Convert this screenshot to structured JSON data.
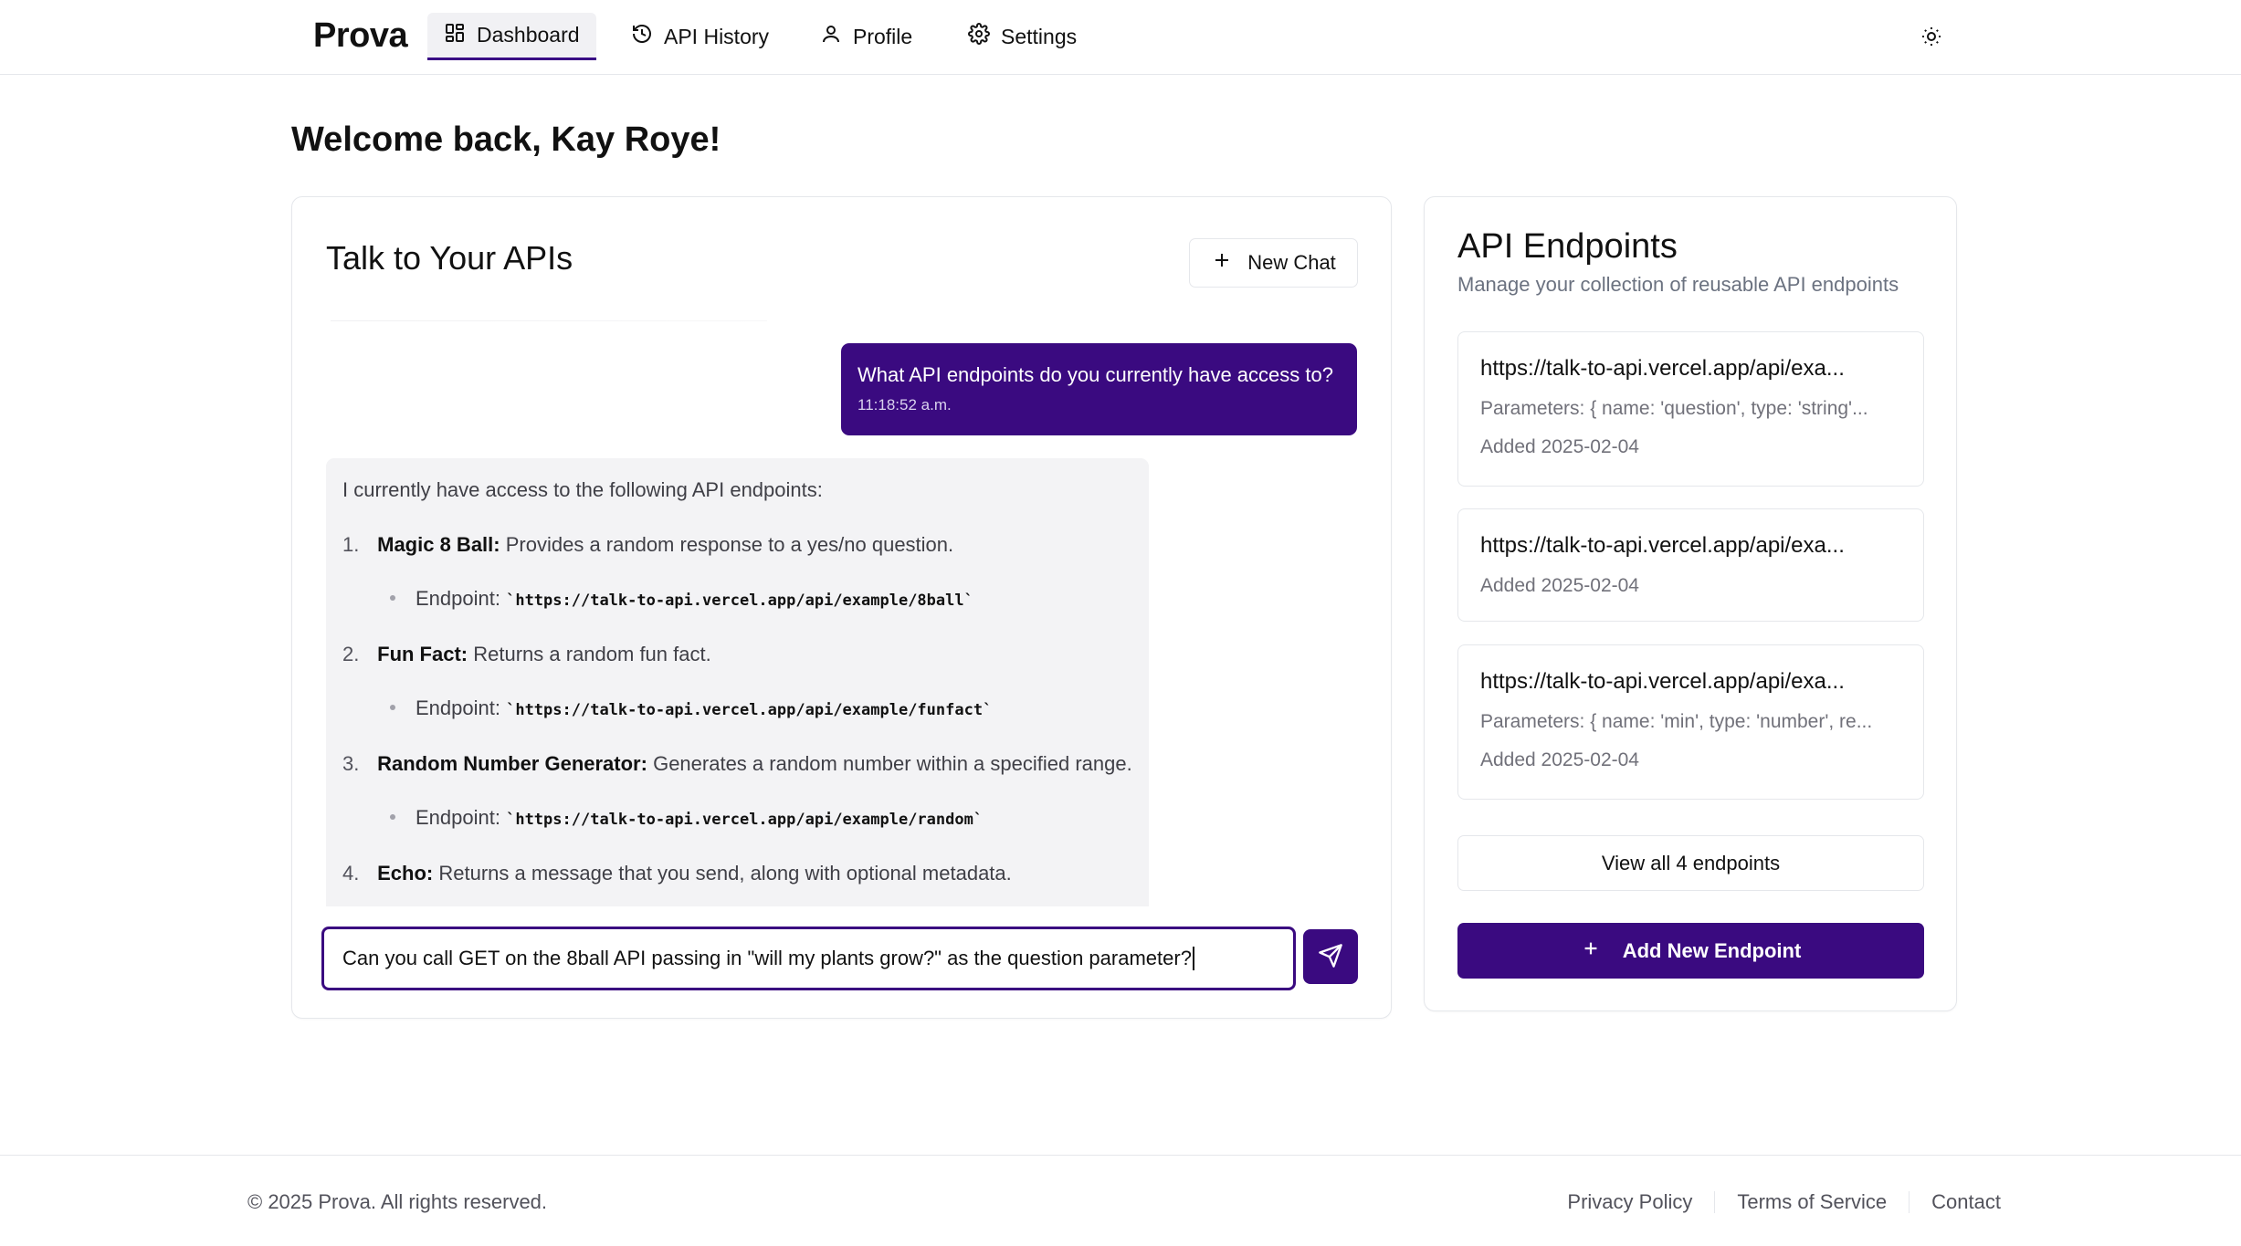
{
  "nav": {
    "brand": "Prova",
    "items": [
      {
        "label": "Dashboard",
        "icon": "dashboard-icon",
        "active": true
      },
      {
        "label": "API History",
        "icon": "history-icon",
        "active": false
      },
      {
        "label": "Profile",
        "icon": "user-icon",
        "active": false
      },
      {
        "label": "Settings",
        "icon": "gear-icon",
        "active": false
      }
    ],
    "theme_icon": "sun-icon"
  },
  "page": {
    "title": "Welcome back, Kay Roye!"
  },
  "chat": {
    "title": "Talk to Your APIs",
    "new_chat_label": "New Chat",
    "user_message": {
      "text": "What API endpoints do you currently have access to?",
      "time": "11:18:52 a.m."
    },
    "bot_message": {
      "intro": "I currently have access to the following API endpoints:",
      "endpoint_prefix": "Endpoint:",
      "items": [
        {
          "num": "1.",
          "name": "Magic 8 Ball:",
          "desc": "Provides a random response to a yes/no question.",
          "endpoint": "`https://talk-to-api.vercel.app/api/example/8ball`"
        },
        {
          "num": "2.",
          "name": "Fun Fact:",
          "desc": "Returns a random fun fact.",
          "endpoint": "`https://talk-to-api.vercel.app/api/example/funfact`"
        },
        {
          "num": "3.",
          "name": "Random Number Generator:",
          "desc": "Generates a random number within a specified range.",
          "endpoint": "`https://talk-to-api.vercel.app/api/example/random`"
        },
        {
          "num": "4.",
          "name": "Echo:",
          "desc": "Returns a message that you send, along with optional metadata.",
          "endpoint": ""
        }
      ]
    },
    "input_value": "Can you call GET on the 8ball API passing in \"will my plants grow?\" as the question parameter?",
    "send_icon": "send-icon"
  },
  "endpoints": {
    "title": "API Endpoints",
    "subtitle": "Manage your collection of reusable API endpoints",
    "items": [
      {
        "url": "https://talk-to-api.vercel.app/api/exa...",
        "params": "Parameters: { name: 'question', type: 'string'...",
        "added": "Added 2025-02-04"
      },
      {
        "url": "https://talk-to-api.vercel.app/api/exa...",
        "params": "",
        "added": "Added 2025-02-04"
      },
      {
        "url": "https://talk-to-api.vercel.app/api/exa...",
        "params": "Parameters: { name: 'min', type: 'number', re...",
        "added": "Added 2025-02-04"
      }
    ],
    "view_all_label": "View all 4 endpoints",
    "add_new_label": "Add New Endpoint"
  },
  "footer": {
    "copyright": "© 2025 Prova. All rights reserved.",
    "links": [
      "Privacy Policy",
      "Terms of Service",
      "Contact"
    ]
  },
  "colors": {
    "accent": "#3a0a80",
    "border": "#e5e7eb",
    "muted_text": "#71717a",
    "bubble_bg": "#f3f3f5"
  }
}
